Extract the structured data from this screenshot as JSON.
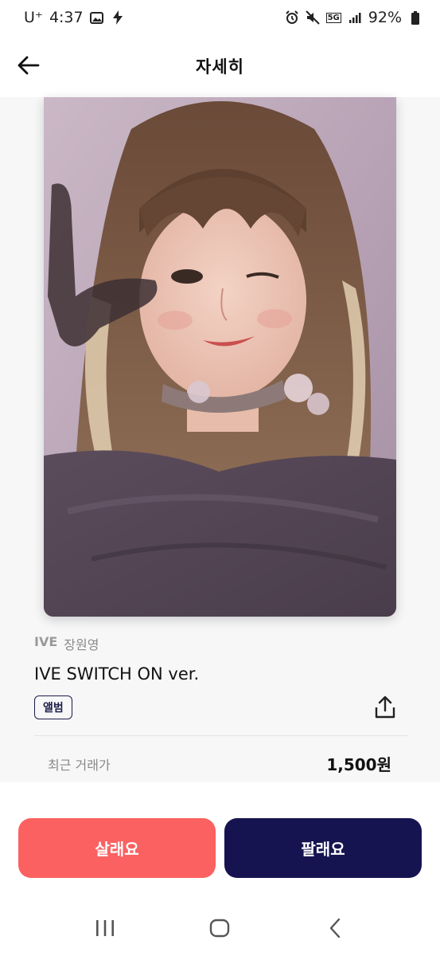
{
  "status_bar": {
    "carrier": "U⁺",
    "time": "4:37",
    "network": "5G",
    "battery": "92%"
  },
  "header": {
    "title": "자세히",
    "back_icon": "arrow-left-icon"
  },
  "product": {
    "group": "IVE",
    "member": "장원영",
    "album": "IVE SWITCH ON ver.",
    "tag": "앨범"
  },
  "price": {
    "label": "최근 거래가",
    "value": "1,500원"
  },
  "actions": {
    "buy_label": "살래요",
    "sell_label": "팔래요"
  },
  "colors": {
    "buy": "#fb6161",
    "sell": "#161450",
    "tag_border": "#1d1d4a"
  },
  "navbar": {
    "icons": [
      "recent-apps-icon",
      "home-icon",
      "back-icon"
    ]
  }
}
